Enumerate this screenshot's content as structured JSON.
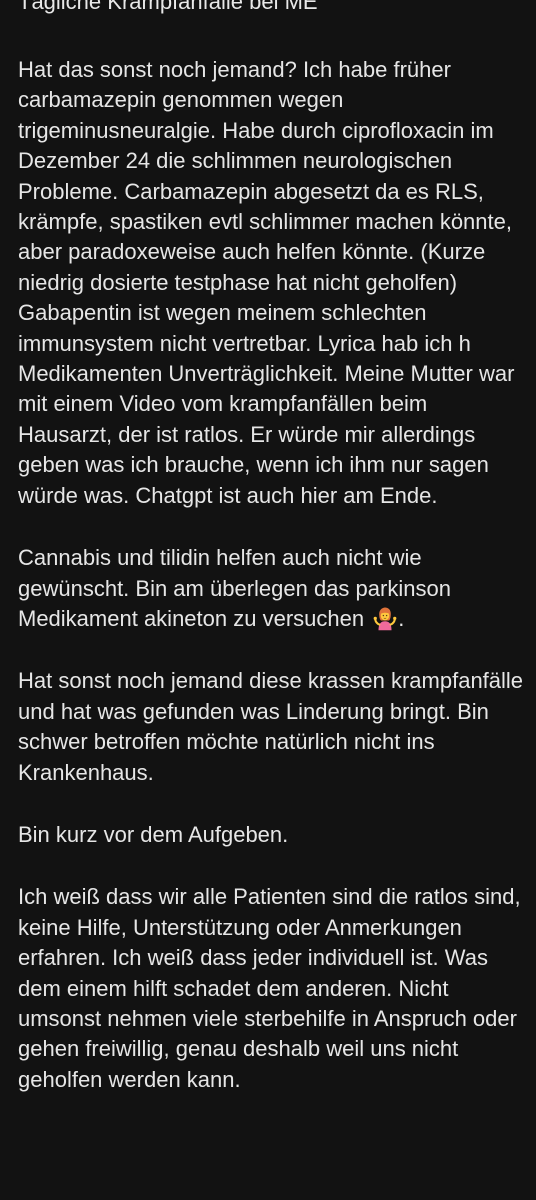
{
  "post": {
    "title": "Tägliche Krampfanfälle bei ME",
    "paragraphs": [
      "Hat das sonst noch jemand? Ich habe früher carbamazepin genommen wegen trigeminusneuralgie. Habe durch ciprofloxacin im Dezember 24 die schlimmen neurologischen Probleme. Carbamazepin abgesetzt da es RLS,  krämpfe,  spastiken evtl schlimmer machen könnte, aber paradoxeweise auch helfen könnte. (Kurze niedrig dosierte testphase hat nicht geholfen) Gabapentin ist wegen meinem schlechten immunsystem nicht vertretbar. Lyrica hab ich h Medikamenten Unverträglichkeit. Meine Mutter war mit einem Video vom krampfanfällen beim Hausarzt,  der ist ratlos. Er würde mir allerdings geben was ich brauche,  wenn ich ihm nur sagen würde was. Chatgpt ist auch hier am Ende.",
      "Cannabis und tilidin helfen auch nicht wie gewünscht. Bin am überlegen das parkinson Medikament akineton zu versuchen",
      "Hat sonst noch jemand diese krassen krampfanfälle und hat was gefunden was Linderung bringt. Bin schwer betroffen möchte natürlich nicht ins Krankenhaus.",
      "Bin kurz vor dem Aufgeben.",
      "Ich weiß dass wir alle Patienten sind die ratlos sind, keine Hilfe,  Unterstützung oder Anmerkungen erfahren. Ich weiß dass jeder individuell ist. Was dem einem hilft schadet dem anderen. Nicht umsonst nehmen viele sterbehilfe in Anspruch oder gehen freiwillig, genau deshalb weil uns nicht geholfen werden kann."
    ],
    "emoji": "person-shrugging-emoji"
  },
  "colors": {
    "background": "#121212",
    "text": "#e6e6e6"
  }
}
